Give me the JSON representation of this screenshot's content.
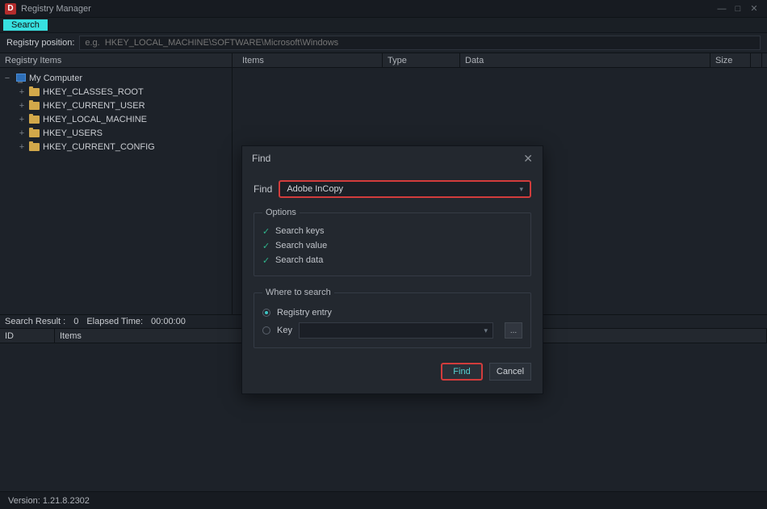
{
  "app": {
    "title": "Registry Manager",
    "icon_letter": "D"
  },
  "window_controls": {
    "min": "—",
    "max": "□",
    "close": "✕"
  },
  "tabs": {
    "search": "Search"
  },
  "pathbar": {
    "label": "Registry position:",
    "placeholder": "e.g.  HKEY_LOCAL_MACHINE\\SOFTWARE\\Microsoft\\Windows"
  },
  "tree": {
    "header": "Registry Items",
    "root": "My Computer",
    "children": [
      "HKEY_CLASSES_ROOT",
      "HKEY_CURRENT_USER",
      "HKEY_LOCAL_MACHINE",
      "HKEY_USERS",
      "HKEY_CURRENT_CONFIG"
    ]
  },
  "list_headers": {
    "items": "Items",
    "type": "Type",
    "data": "Data",
    "size": "Size"
  },
  "resultbar": {
    "label": "Search Result :",
    "count": "0",
    "elapsed_label": "Elapsed Time:",
    "elapsed": "00:00:00"
  },
  "result_headers": {
    "id": "ID",
    "items": "Items"
  },
  "statusbar": {
    "version_label": "Version:",
    "version": "1.21.8.2302"
  },
  "dialog": {
    "title": "Find",
    "find_label": "Find",
    "find_value": "Adobe InCopy",
    "options_legend": "Options",
    "opt_keys": "Search keys",
    "opt_value": "Search value",
    "opt_data": "Search data",
    "where_legend": "Where to search",
    "where_entry": "Registry entry",
    "where_key": "Key",
    "key_picker": "...",
    "btn_find": "Find",
    "btn_cancel": "Cancel"
  }
}
